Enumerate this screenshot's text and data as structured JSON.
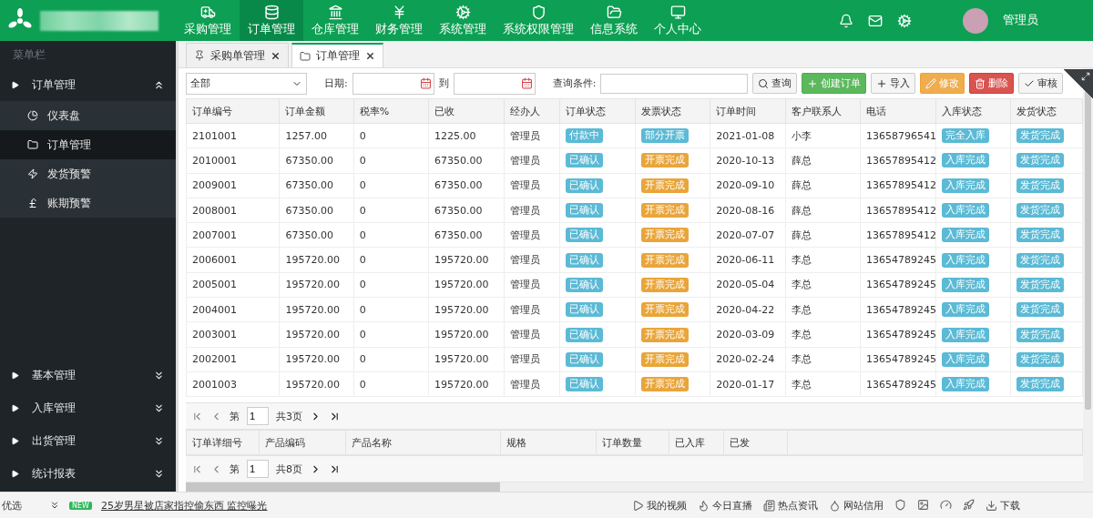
{
  "topbar": {
    "nav": [
      {
        "label": "采购管理",
        "selected": false
      },
      {
        "label": "订单管理",
        "selected": true
      },
      {
        "label": "仓库管理",
        "selected": false
      },
      {
        "label": "财务管理",
        "selected": false
      },
      {
        "label": "系统管理",
        "selected": false
      },
      {
        "label": "系统权限管理",
        "selected": false
      },
      {
        "label": "信息系统",
        "selected": false
      },
      {
        "label": "个人中心",
        "selected": false
      }
    ],
    "user": "管理员"
  },
  "sidebar": {
    "title": "菜单栏",
    "groups": [
      {
        "label": "订单管理",
        "expanded": true,
        "children": [
          {
            "label": "仪表盘",
            "selected": false
          },
          {
            "label": "订单管理",
            "selected": true
          },
          {
            "label": "发货预警",
            "selected": false
          },
          {
            "label": "账期预警",
            "selected": false
          }
        ]
      }
    ],
    "bottom_groups": [
      {
        "label": "基本管理",
        "expanded": false
      },
      {
        "label": "入库管理",
        "expanded": false
      },
      {
        "label": "出货管理",
        "expanded": false
      },
      {
        "label": "统计报表",
        "expanded": false
      }
    ]
  },
  "tabs": [
    {
      "label": "采购单管理",
      "selected": false
    },
    {
      "label": "订单管理",
      "selected": true
    }
  ],
  "filter": {
    "select_value": "全部",
    "date_label": "日期:",
    "to_label": "到",
    "query_label": "查询条件:"
  },
  "buttons": [
    {
      "label": "查询",
      "kind": "default"
    },
    {
      "label": "创建订单",
      "kind": "success"
    },
    {
      "label": "导入",
      "kind": "default"
    },
    {
      "label": "修改",
      "kind": "warning"
    },
    {
      "label": "删除",
      "kind": "danger"
    },
    {
      "label": "审核",
      "kind": "default"
    }
  ],
  "table": {
    "columns": [
      "订单编号",
      "订单金额",
      "税率%",
      "已收",
      "经办人",
      "订单状态",
      "发票状态",
      "订单时间",
      "客户联系人",
      "电话",
      "入库状态",
      "发货状态"
    ],
    "rows": [
      {
        "cells": [
          "2101001",
          "1257.00",
          "0",
          "1225.00",
          "管理员",
          {
            "text": "付款中",
            "color": "#5bbad5"
          },
          {
            "text": "部分开票",
            "color": "#5bbad5"
          },
          "2021-01-08",
          "小李",
          "13658796541",
          {
            "text": "完全入库",
            "color": "#5bbad5"
          },
          {
            "text": "发货完成",
            "color": "#5bbad5"
          }
        ]
      },
      {
        "cells": [
          "2010001",
          "67350.00",
          "0",
          "67350.00",
          "管理员",
          {
            "text": "已确认",
            "color": "#5bbad5"
          },
          {
            "text": "开票完成",
            "color": "#e9a53a"
          },
          "2020-10-13",
          "薛总",
          "13657895412",
          {
            "text": "入库完成",
            "color": "#5bbad5"
          },
          {
            "text": "发货完成",
            "color": "#5bbad5"
          }
        ]
      },
      {
        "cells": [
          "2009001",
          "67350.00",
          "0",
          "67350.00",
          "管理员",
          {
            "text": "已确认",
            "color": "#5bbad5"
          },
          {
            "text": "开票完成",
            "color": "#e9a53a"
          },
          "2020-09-10",
          "薛总",
          "13657895412",
          {
            "text": "入库完成",
            "color": "#5bbad5"
          },
          {
            "text": "发货完成",
            "color": "#5bbad5"
          }
        ]
      },
      {
        "cells": [
          "2008001",
          "67350.00",
          "0",
          "67350.00",
          "管理员",
          {
            "text": "已确认",
            "color": "#5bbad5"
          },
          {
            "text": "开票完成",
            "color": "#e9a53a"
          },
          "2020-08-16",
          "薛总",
          "13657895412",
          {
            "text": "入库完成",
            "color": "#5bbad5"
          },
          {
            "text": "发货完成",
            "color": "#5bbad5"
          }
        ]
      },
      {
        "cells": [
          "2007001",
          "67350.00",
          "0",
          "67350.00",
          "管理员",
          {
            "text": "已确认",
            "color": "#5bbad5"
          },
          {
            "text": "开票完成",
            "color": "#e9a53a"
          },
          "2020-07-07",
          "薛总",
          "13657895412",
          {
            "text": "入库完成",
            "color": "#5bbad5"
          },
          {
            "text": "发货完成",
            "color": "#5bbad5"
          }
        ]
      },
      {
        "cells": [
          "2006001",
          "195720.00",
          "0",
          "195720.00",
          "管理员",
          {
            "text": "已确认",
            "color": "#5bbad5"
          },
          {
            "text": "开票完成",
            "color": "#e9a53a"
          },
          "2020-06-11",
          "李总",
          "13654789245",
          {
            "text": "入库完成",
            "color": "#5bbad5"
          },
          {
            "text": "发货完成",
            "color": "#5bbad5"
          }
        ]
      },
      {
        "cells": [
          "2005001",
          "195720.00",
          "0",
          "195720.00",
          "管理员",
          {
            "text": "已确认",
            "color": "#5bbad5"
          },
          {
            "text": "开票完成",
            "color": "#e9a53a"
          },
          "2020-05-04",
          "李总",
          "13654789245",
          {
            "text": "入库完成",
            "color": "#5bbad5"
          },
          {
            "text": "发货完成",
            "color": "#5bbad5"
          }
        ]
      },
      {
        "cells": [
          "2004001",
          "195720.00",
          "0",
          "195720.00",
          "管理员",
          {
            "text": "已确认",
            "color": "#5bbad5"
          },
          {
            "text": "开票完成",
            "color": "#e9a53a"
          },
          "2020-04-22",
          "李总",
          "13654789245",
          {
            "text": "入库完成",
            "color": "#5bbad5"
          },
          {
            "text": "发货完成",
            "color": "#5bbad5"
          }
        ]
      },
      {
        "cells": [
          "2003001",
          "195720.00",
          "0",
          "195720.00",
          "管理员",
          {
            "text": "已确认",
            "color": "#5bbad5"
          },
          {
            "text": "开票完成",
            "color": "#e9a53a"
          },
          "2020-03-09",
          "李总",
          "13654789245",
          {
            "text": "入库完成",
            "color": "#5bbad5"
          },
          {
            "text": "发货完成",
            "color": "#5bbad5"
          }
        ]
      },
      {
        "cells": [
          "2002001",
          "195720.00",
          "0",
          "195720.00",
          "管理员",
          {
            "text": "已确认",
            "color": "#5bbad5"
          },
          {
            "text": "开票完成",
            "color": "#e9a53a"
          },
          "2020-02-24",
          "李总",
          "13654789245",
          {
            "text": "入库完成",
            "color": "#5bbad5"
          },
          {
            "text": "发货完成",
            "color": "#5bbad5"
          }
        ]
      },
      {
        "cells": [
          "2001003",
          "195720.00",
          "0",
          "195720.00",
          "管理员",
          {
            "text": "已确认",
            "color": "#5bbad5"
          },
          {
            "text": "开票完成",
            "color": "#e9a53a"
          },
          "2020-01-17",
          "李总",
          "13654789245",
          {
            "text": "入库完成",
            "color": "#5bbad5"
          },
          {
            "text": "发货完成",
            "color": "#5bbad5"
          }
        ]
      }
    ]
  },
  "pager": {
    "page_prefix": "第",
    "page": "1",
    "total": "共3页"
  },
  "detail": {
    "columns": [
      "订单详细号",
      "产品编码",
      "产品名称",
      "规格",
      "订单数量",
      "已入库",
      "已发"
    ]
  },
  "detail_pager": {
    "page_prefix": "第",
    "page": "1",
    "total": "共8页"
  },
  "browser_bar": {
    "left_text": "优选",
    "badge": "NEW",
    "headline": "25岁男星被店家指控偷东西 监控曝光",
    "items": [
      "我的视频",
      "今日直播",
      "热点资讯",
      "网站信用"
    ],
    "download": "下载"
  }
}
